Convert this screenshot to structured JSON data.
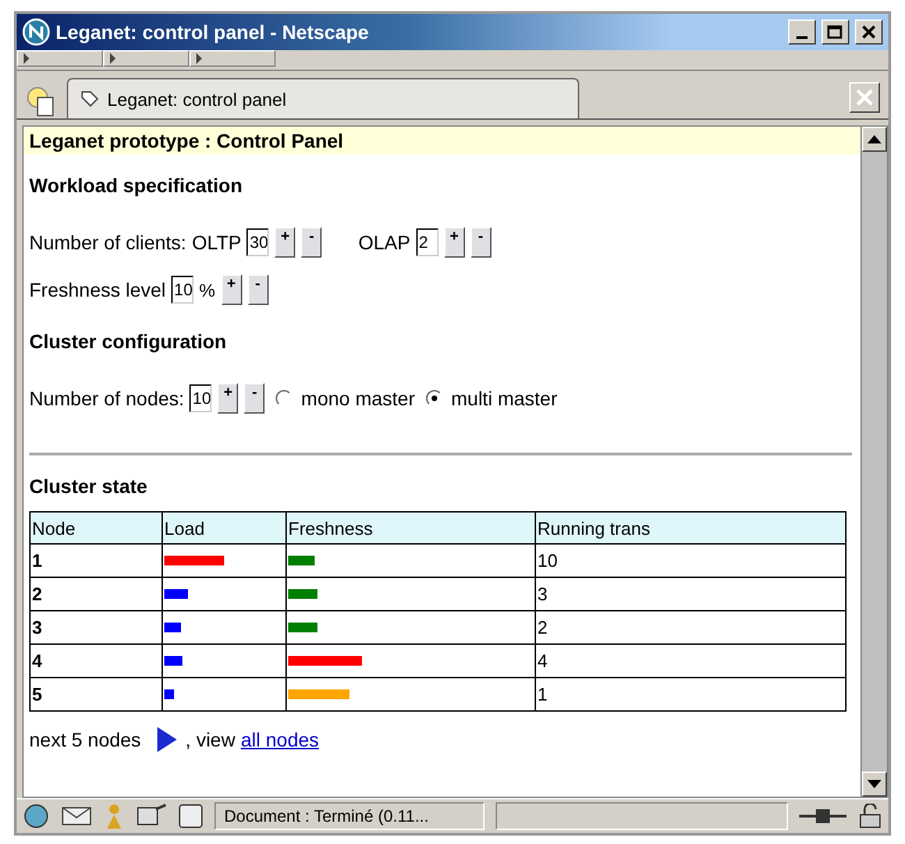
{
  "window": {
    "title": "Leganet: control panel - Netscape"
  },
  "tab": {
    "label": "Leganet: control panel",
    "selected": true
  },
  "page": {
    "title": "Leganet prototype : Control Panel",
    "workload": {
      "heading": "Workload specification",
      "clients_label": "Number of clients:",
      "fields": [
        {
          "label": "OLTP",
          "value": "30",
          "plus": "+",
          "minus": "-"
        },
        {
          "label": "OLAP",
          "value": "2",
          "plus": "+",
          "minus": "-"
        }
      ],
      "freshness": {
        "label": "Freshness level",
        "value": "10",
        "unit": "%",
        "plus": "+",
        "minus": "-"
      }
    },
    "cluster": {
      "heading": "Cluster configuration",
      "nodes": {
        "label": "Number of nodes:",
        "value": "10",
        "plus": "+",
        "minus": "-"
      },
      "modes": [
        {
          "label": "mono master",
          "selected": false
        },
        {
          "label": "multi master",
          "selected": true
        }
      ]
    },
    "state": {
      "heading": "Cluster state",
      "columns": [
        "Node",
        "Load",
        "Freshness",
        "Running trans"
      ],
      "rows": [
        {
          "node": "1",
          "load": {
            "level": 0.5,
            "color": "#ff0000"
          },
          "freshness": {
            "level": 0.11,
            "color": "#008000"
          },
          "running": "10"
        },
        {
          "node": "2",
          "load": {
            "level": 0.2,
            "color": "#0000ff"
          },
          "freshness": {
            "level": 0.12,
            "color": "#008000"
          },
          "running": "3"
        },
        {
          "node": "3",
          "load": {
            "level": 0.14,
            "color": "#0000ff"
          },
          "freshness": {
            "level": 0.12,
            "color": "#008000"
          },
          "running": "2"
        },
        {
          "node": "4",
          "load": {
            "level": 0.15,
            "color": "#0000ff"
          },
          "freshness": {
            "level": 0.3,
            "color": "#ff0000"
          },
          "running": "4"
        },
        {
          "node": "5",
          "load": {
            "level": 0.08,
            "color": "#0000ff"
          },
          "freshness": {
            "level": 0.25,
            "color": "#ffa500"
          },
          "running": "1"
        }
      ],
      "next_label": "next 5 nodes",
      "view_label": ", view",
      "all_link": "all nodes"
    }
  },
  "status_bar": {
    "text": "Document : Terminé (0.11..."
  }
}
